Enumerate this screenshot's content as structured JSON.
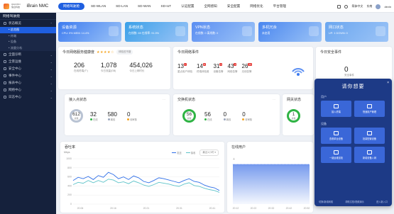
{
  "app": {
    "company_line1": "QIAOXIN",
    "company_line2": "信息科技",
    "title": "iBrain NMC"
  },
  "nav": [
    "网络驾驶舱",
    "SD-WLAN",
    "SD-LAN",
    "SD-WAN",
    "SD-IoT",
    "认证配置",
    "全网感知",
    "安全配置",
    "网络优化",
    "平台管理"
  ],
  "topright": {
    "lang": "简体中文",
    "region": "东南",
    "user": "devin"
  },
  "sidebar": {
    "header": "网络驾驶舱",
    "items": [
      {
        "label": "状态概览",
        "expanded": true,
        "subs": [
          "总览图",
          "终端",
          "设备",
          "流量分析"
        ]
      },
      {
        "label": "全面诊断"
      },
      {
        "label": "全景运维"
      },
      {
        "label": "安全中心"
      },
      {
        "label": "事件中心"
      },
      {
        "label": "报表中心"
      },
      {
        "label": "网络中心"
      },
      {
        "label": "日志中心"
      }
    ]
  },
  "stat_cards": [
    {
      "title": "设备资源",
      "line": "CPU: 9%    MEM: 14.4%",
      "color": "#3d7bf0"
    },
    {
      "title": "系统状态",
      "line": "在线数: 69    在线率: 91.9%",
      "color": "#3aa0e8"
    },
    {
      "title": "VPN状态",
      "line": "在线数: 0    离线数: 0",
      "color": "#5b8ef2"
    },
    {
      "title": "多机冗余",
      "line": "未启用",
      "color": "#4a86ef"
    },
    {
      "title": "网口状态",
      "line": "UP: 1    DOWN: 0",
      "color": "#6aa6ef"
    }
  ],
  "health": {
    "title": "今日网络服务健康度",
    "rating_label": "体验还不错",
    "stars": 4,
    "kpis": [
      {
        "value": "206",
        "label": "在线终端(个)"
      },
      {
        "value": "1,078",
        "label": "今日流量(GB)"
      },
      {
        "value": "454,026",
        "label": "今日上网时长"
      }
    ]
  },
  "events": {
    "title": "今日网络事件",
    "items": [
      {
        "value": "13",
        "badge": "1",
        "label": "重点用户体验"
      },
      {
        "value": "14",
        "badge": "8",
        "label": "终端体验差"
      },
      {
        "value": "31",
        "badge": "4",
        "label": "设备告警"
      },
      {
        "value": "43",
        "badge": "4",
        "label": "网络告警"
      },
      {
        "value": "26",
        "badge": "13",
        "label": "无线告警"
      }
    ]
  },
  "security": {
    "title": "今日安全事件",
    "value": "0",
    "label": "安全事件"
  },
  "access": {
    "title": "接入点状态",
    "ring_value": "612",
    "ring_label": "总数",
    "vals": [
      "32",
      "580",
      "0"
    ],
    "legends": [
      "在线",
      "离线",
      "待审核"
    ]
  },
  "switch": {
    "title": "交换机状态",
    "ring_value": "56",
    "ring_label": "总数",
    "vals": [
      "56",
      "0",
      "0"
    ],
    "legends": [
      "在线",
      "离线",
      "待审核"
    ]
  },
  "gateway": {
    "title": "网关状态",
    "ring_value": "1",
    "ring_label": "总数",
    "vals": [
      "1",
      "0"
    ],
    "legends": [
      "在线",
      "离线"
    ]
  },
  "throughput": {
    "title": "吞吐率",
    "unit": "Mbps",
    "legend_up": "发送",
    "legend_down": "接收",
    "filter": "最近1小时"
  },
  "online_users": {
    "title": "在线用户"
  },
  "popup": {
    "title": "请你想要",
    "sec1": "用户",
    "sec1_btns": [
      "接入终端",
      "快速用户管理"
    ],
    "sec2": "设备",
    "sec2_btns": [
      "查看单台设备",
      "批量配置设备",
      "一键运维巡检",
      "新增设备入网"
    ],
    "foot_left": "切换/新增网络",
    "foot_mid": "帮助文档/视频演示",
    "foot_right": "进入新入口"
  },
  "chart_data": [
    {
      "type": "line",
      "title": "吞吐率",
      "ylabel": "Mbps",
      "ylim": [
        0,
        1000
      ],
      "yticks": [
        0,
        200,
        400,
        600,
        800,
        1000
      ],
      "x": [
        "20:06",
        "20:16",
        "20:21",
        "20:31",
        "20:41"
      ],
      "series": [
        {
          "name": "发送",
          "color": "#2f6fe8",
          "values": [
            520,
            590,
            560,
            610,
            540,
            630,
            590,
            700,
            650,
            560,
            600,
            540,
            620,
            580,
            500,
            470,
            520,
            580,
            560,
            530,
            500,
            470,
            520,
            560,
            500,
            480,
            420,
            380,
            360,
            300
          ]
        },
        {
          "name": "接收",
          "color": "#5dc3c9",
          "values": [
            430,
            480,
            460,
            520,
            470,
            520,
            480,
            550,
            530,
            470,
            490,
            450,
            510,
            470,
            420,
            390,
            430,
            480,
            460,
            440,
            410,
            390,
            440,
            470,
            410,
            390,
            350,
            320,
            300,
            260
          ]
        }
      ]
    },
    {
      "type": "area",
      "title": "在线用户",
      "ylim": [
        0,
        250
      ],
      "x": [
        "20:12",
        "20:22",
        "20:32",
        "20:42",
        "20:52"
      ],
      "series": [
        {
          "name": "",
          "color": "#3b6fe6",
          "values": [
            206,
            206,
            206,
            206,
            206,
            206,
            206,
            206,
            206,
            206,
            206,
            206,
            206,
            206,
            206,
            206,
            206,
            206,
            206,
            206
          ]
        }
      ]
    }
  ]
}
